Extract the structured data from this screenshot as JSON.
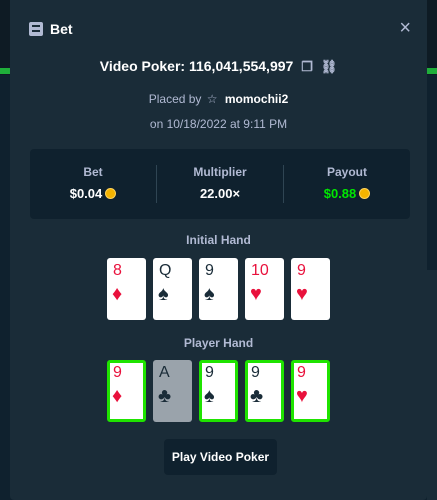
{
  "modal": {
    "title": "Bet",
    "close_symbol": "×"
  },
  "bet_info": {
    "game_name": "Video Poker: 116,041,554,997",
    "placed_by_prefix": "Placed by",
    "username": "momochii2",
    "date_line": "on 10/18/2022 at 9:11 PM"
  },
  "stats": {
    "bet_label": "Bet",
    "bet_value": "$0.04",
    "multiplier_label": "Multiplier",
    "multiplier_value": "22.00×",
    "payout_label": "Payout",
    "payout_value": "$0.88"
  },
  "initial_hand": {
    "label": "Initial Hand",
    "cards": [
      {
        "rank": "8",
        "suit": "♦",
        "color": "red"
      },
      {
        "rank": "Q",
        "suit": "♠",
        "color": "black"
      },
      {
        "rank": "9",
        "suit": "♠",
        "color": "black"
      },
      {
        "rank": "10",
        "suit": "♥",
        "color": "red"
      },
      {
        "rank": "9",
        "suit": "♥",
        "color": "red"
      }
    ]
  },
  "player_hand": {
    "label": "Player Hand",
    "cards": [
      {
        "rank": "9",
        "suit": "♦",
        "color": "red",
        "held": true
      },
      {
        "rank": "A",
        "suit": "♣",
        "color": "black",
        "held": false
      },
      {
        "rank": "9",
        "suit": "♠",
        "color": "black",
        "held": true
      },
      {
        "rank": "9",
        "suit": "♣",
        "color": "black",
        "held": true
      },
      {
        "rank": "9",
        "suit": "♥",
        "color": "red",
        "held": true
      }
    ]
  },
  "actions": {
    "play_label": "Play Video Poker"
  },
  "icons": {
    "bet": "bet-list-icon",
    "close": "close-icon",
    "copy": "copy-icon",
    "link": "link-icon",
    "user": "star-icon",
    "currency": "coin-icon"
  },
  "colors": {
    "modal_bg": "#1a2c38",
    "panel_bg": "#0f212e",
    "muted_text": "#b1bad3",
    "payout_green": "#00e701",
    "held_border": "#1fe300",
    "card_red": "#e9113c"
  }
}
